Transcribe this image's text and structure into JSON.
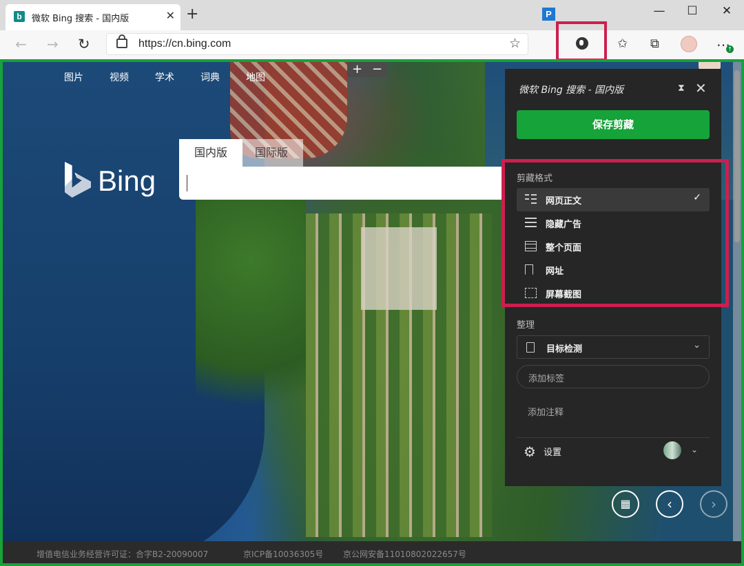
{
  "browser": {
    "tab_title": "微软 Bing 搜索 - 国内版",
    "tab_favicon": "b",
    "url": "https://cn.bing.com",
    "extension_badge": "P",
    "update_badge": "↑",
    "window_controls": {
      "minimize": "—",
      "maximize": "☐",
      "close": "✕"
    }
  },
  "bing": {
    "nav": [
      "图片",
      "视频",
      "学术",
      "词典",
      "地图"
    ],
    "logo": "Bing",
    "search_tabs": [
      "国内版",
      "国际版"
    ],
    "zoom": {
      "plus": "+",
      "minus": "−"
    },
    "footer": [
      "增值电信业务经营许可证：合字B2-20090007",
      "京ICP备10036305号",
      "京公网安备11010802022657号"
    ]
  },
  "evernote": {
    "title": "微软 Bing 搜索 - 国内版",
    "save_button": "保存剪藏",
    "format_label": "剪藏格式",
    "formats": [
      {
        "label": "网页正文",
        "icon": "article-icon",
        "selected": true
      },
      {
        "label": "隐藏广告",
        "icon": "lines-icon",
        "selected": false
      },
      {
        "label": "整个页面",
        "icon": "page-icon",
        "selected": false
      },
      {
        "label": "网址",
        "icon": "bookmark-icon",
        "selected": false
      },
      {
        "label": "屏幕截图",
        "icon": "screenshot-icon",
        "selected": false
      }
    ],
    "organize_label": "整理",
    "notebook": "目标检测",
    "tag_placeholder": "添加标签",
    "note_placeholder": "添加注释",
    "settings_label": "设置",
    "checkmark": "✓"
  },
  "colors": {
    "accent_green": "#16a33a",
    "highlight_red": "#cc1f4f",
    "panel_bg": "#262626"
  }
}
